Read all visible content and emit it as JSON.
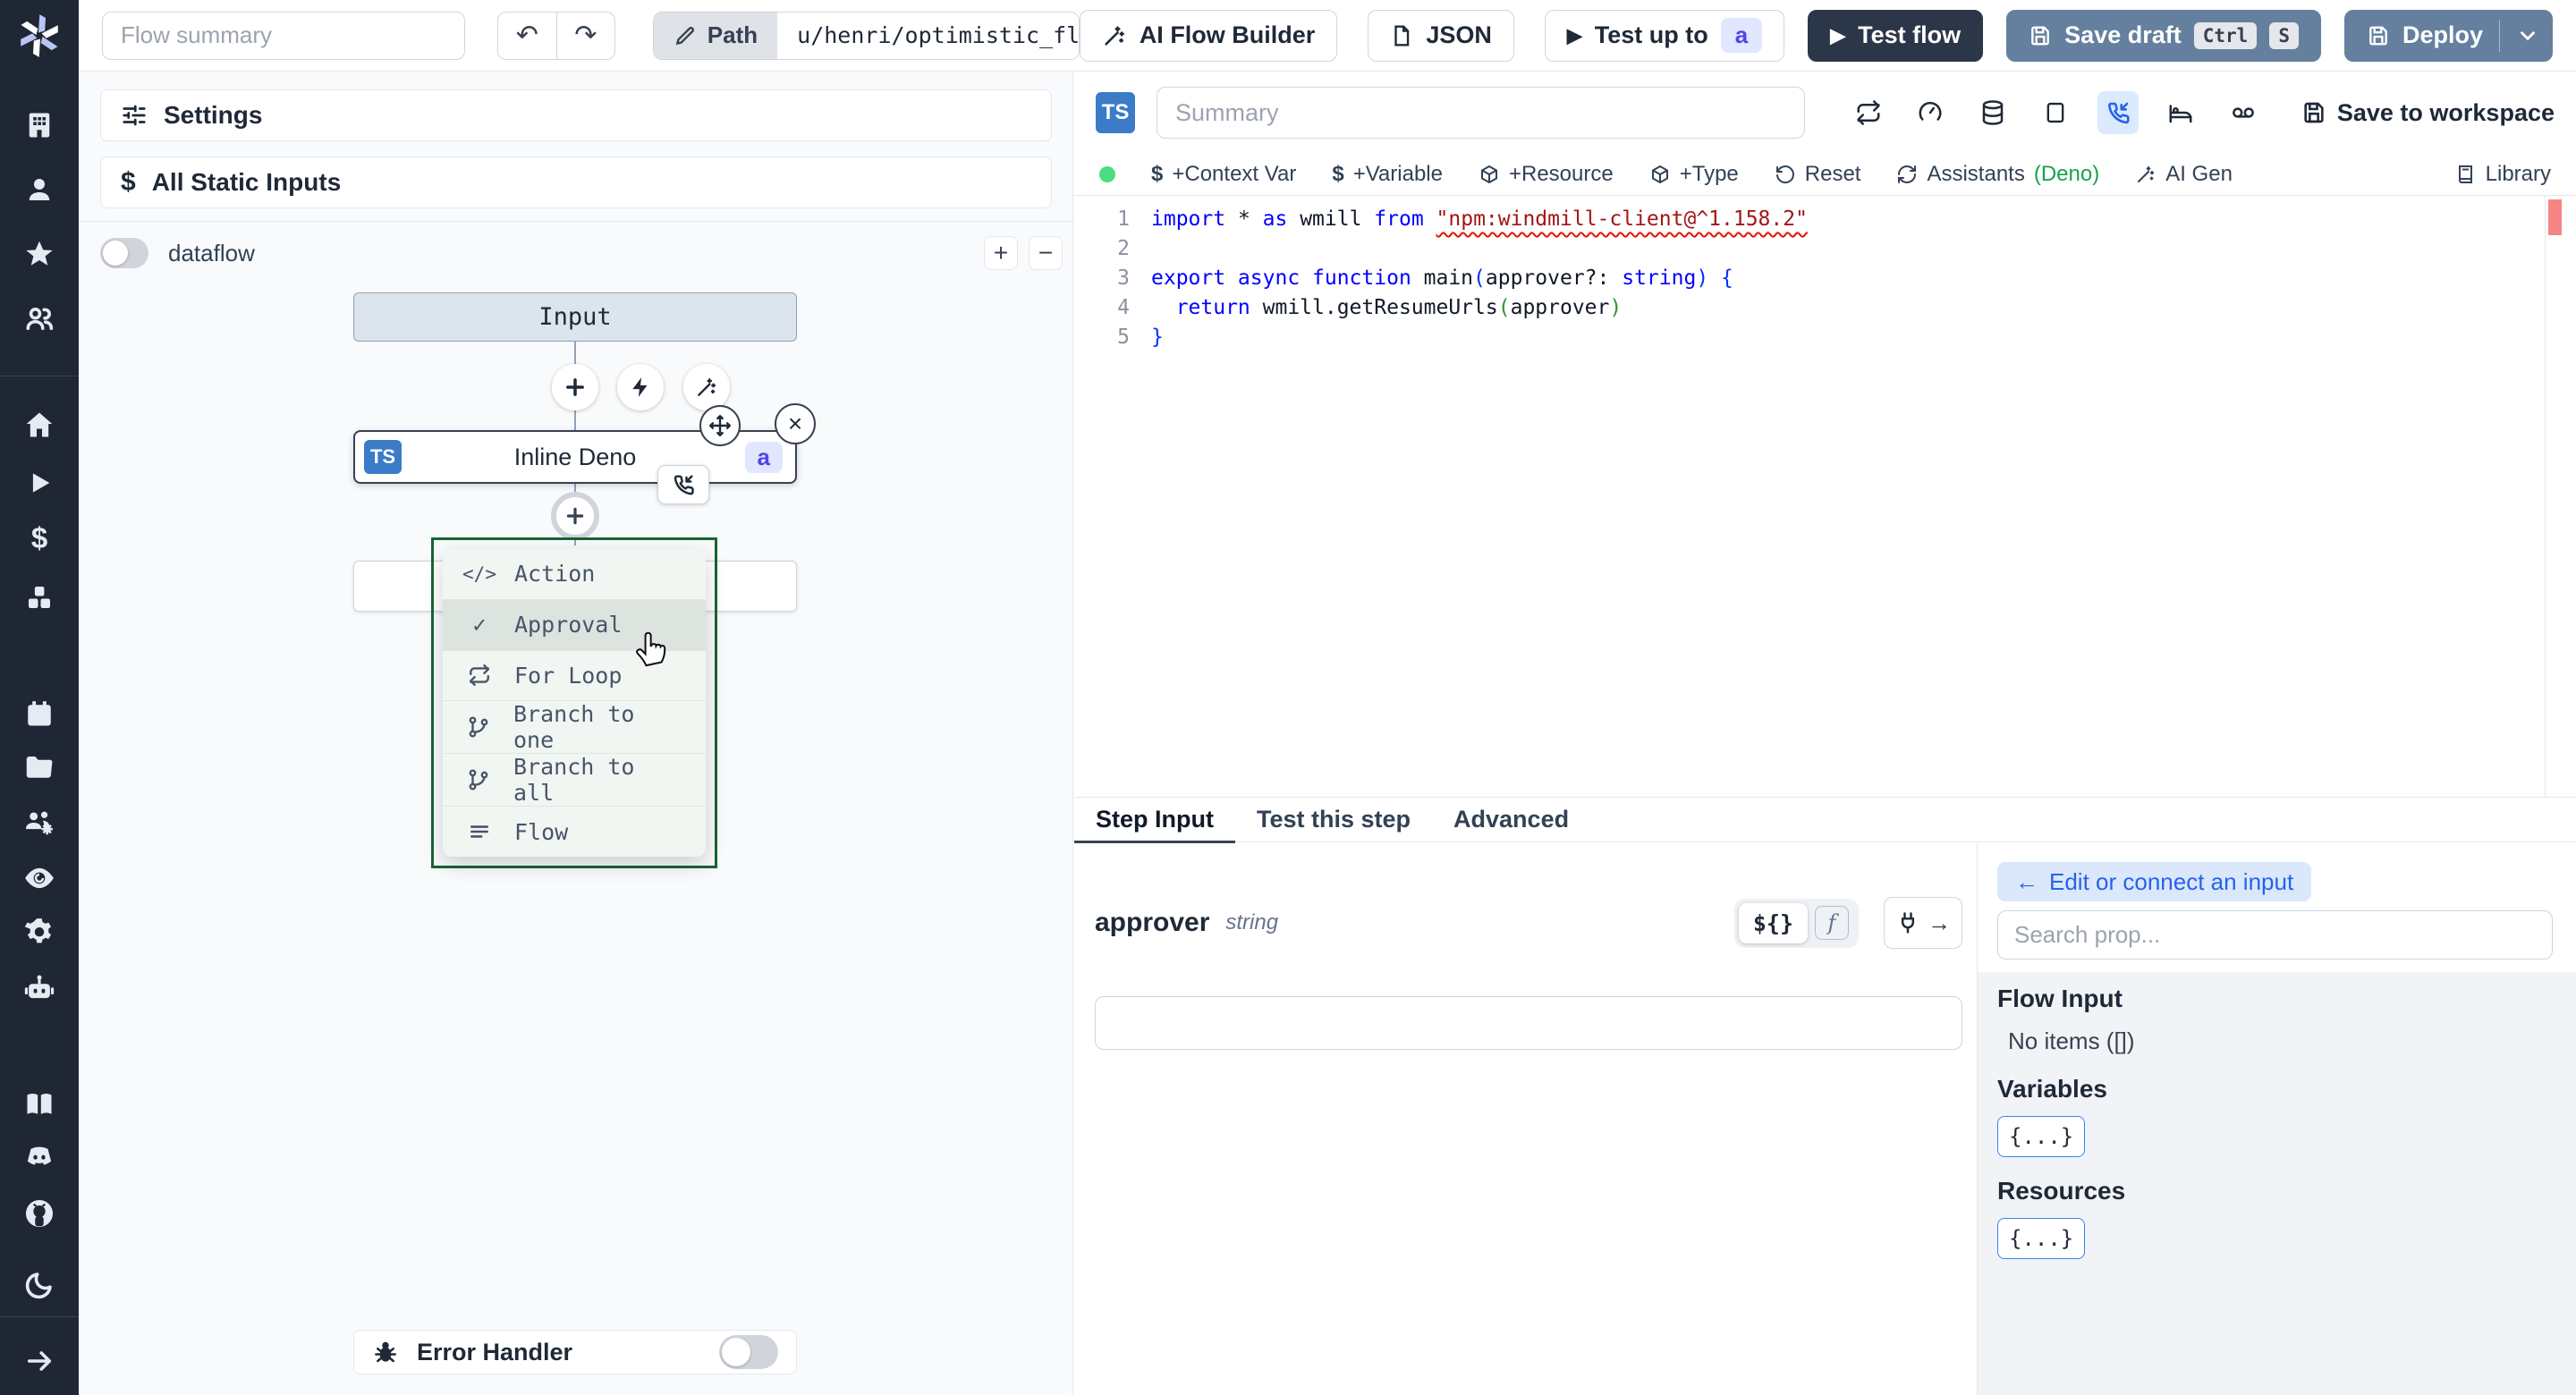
{
  "topbar": {
    "flow_summary_placeholder": "Flow summary",
    "path_label": "Path",
    "path_value": "u/henri/optimistic_flow",
    "ai_flow_builder": "AI Flow Builder",
    "json_label": "JSON",
    "test_up_to": "Test up to",
    "test_up_to_badge": "a",
    "test_flow": "Test flow",
    "save_draft": "Save draft",
    "kbd_ctrl": "Ctrl",
    "kbd_s": "S",
    "deploy": "Deploy"
  },
  "left_panel": {
    "settings": "Settings",
    "all_static_inputs": "All Static Inputs",
    "dataflow": "dataflow",
    "error_handler": "Error Handler",
    "zoom_in": "+",
    "zoom_out": "−"
  },
  "graph": {
    "input_node": "Input",
    "step_node": "Inline Deno",
    "step_badge_ts": "TS",
    "step_badge_id": "a"
  },
  "flow_menu": {
    "items": [
      {
        "label": "Action"
      },
      {
        "label": "Approval"
      },
      {
        "label": "For Loop"
      },
      {
        "label": "Branch to one"
      },
      {
        "label": "Branch to all"
      },
      {
        "label": "Flow"
      }
    ]
  },
  "editor": {
    "lang_badge": "TS",
    "summary_placeholder": "Summary",
    "save_to_workspace": "Save to workspace",
    "toolbar": {
      "context_var": "+Context Var",
      "variable": "+Variable",
      "resource": "+Resource",
      "type": "+Type",
      "reset": "Reset",
      "assistants": "Assistants",
      "assistants_lang": "(Deno)",
      "ai_gen": "AI Gen",
      "library": "Library"
    },
    "code": {
      "lines": [
        [
          {
            "t": "import ",
            "c": "kw"
          },
          {
            "t": "* ",
            "c": "p"
          },
          {
            "t": "as",
            "c": "kw"
          },
          {
            "t": " wmill ",
            "c": "p"
          },
          {
            "t": "from ",
            "c": "kw"
          },
          {
            "t": "\"npm:windmill-client@^1.158.2\"",
            "c": "str err"
          }
        ],
        [],
        [
          {
            "t": "export async function ",
            "c": "kw"
          },
          {
            "t": "main",
            "c": "p"
          },
          {
            "t": "(",
            "c": "br1"
          },
          {
            "t": "approver?: ",
            "c": "p"
          },
          {
            "t": "string",
            "c": "kw"
          },
          {
            "t": ")",
            "c": "br1"
          },
          {
            "t": " {",
            "c": "br1"
          }
        ],
        [
          {
            "t": "  return",
            "c": "kw"
          },
          {
            "t": " wmill.getResumeUrls",
            "c": "p"
          },
          {
            "t": "(",
            "c": "br2"
          },
          {
            "t": "approver",
            "c": "p"
          },
          {
            "t": ")",
            "c": "br2"
          }
        ],
        [
          {
            "t": "}",
            "c": "br1"
          }
        ]
      ]
    }
  },
  "bottom": {
    "tabs": [
      "Step Input",
      "Test this step",
      "Advanced"
    ],
    "field_name": "approver",
    "field_type": "string",
    "expr_toggle": "${}",
    "fn_toggle": "f"
  },
  "connect_panel": {
    "edit_connect": "Edit or connect an input",
    "search_placeholder": "Search prop...",
    "flow_input_title": "Flow Input",
    "flow_input_empty": "No items ([])",
    "variables_title": "Variables",
    "resources_title": "Resources",
    "object_chip": "{...}"
  },
  "colors": {
    "accent_blue": "#2563eb",
    "deno_green": "#16a34a",
    "menu_border_green": "#166534",
    "action_slate": "#64809e",
    "dark_navy": "#2b3648"
  }
}
